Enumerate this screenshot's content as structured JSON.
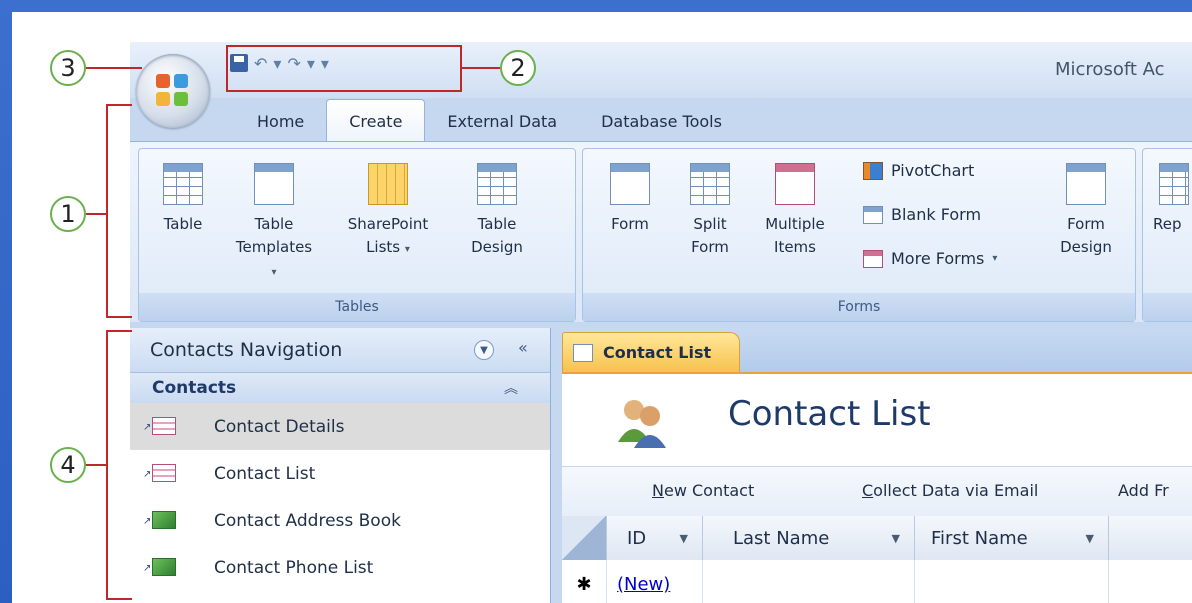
{
  "window": {
    "title": "Microsoft Ac",
    "quick_access": {
      "save": "",
      "undo": "↶",
      "redo": "↷",
      "dropdown": "▾"
    }
  },
  "tabs": [
    {
      "label": "Home",
      "active": false
    },
    {
      "label": "Create",
      "active": true
    },
    {
      "label": "External Data",
      "active": false
    },
    {
      "label": "Database Tools",
      "active": false
    }
  ],
  "ribbon": {
    "tables_group": {
      "label": "Tables",
      "table": "Table",
      "table_templates_1": "Table",
      "table_templates_2": "Templates",
      "sharepoint_1": "SharePoint",
      "sharepoint_2": "Lists",
      "table_design_1": "Table",
      "table_design_2": "Design"
    },
    "forms_group": {
      "label": "Forms",
      "form": "Form",
      "split_form_1": "Split",
      "split_form_2": "Form",
      "multiple_items_1": "Multiple",
      "multiple_items_2": "Items",
      "pivotchart": "PivotChart",
      "blank_form": "Blank Form",
      "more_forms": "More Forms",
      "form_design_1": "Form",
      "form_design_2": "Design"
    },
    "reports_partial": "Rep"
  },
  "callouts": {
    "c1": "1",
    "c2": "2",
    "c3": "3",
    "c4": "4"
  },
  "navigation": {
    "title": "Contacts Navigation",
    "collapse": "«",
    "group": "Contacts",
    "group_chevron": "≈",
    "items": [
      {
        "label": "Contact Details",
        "type": "form",
        "selected": true
      },
      {
        "label": "Contact List",
        "type": "form",
        "selected": false
      },
      {
        "label": "Contact Address Book",
        "type": "report",
        "selected": false
      },
      {
        "label": "Contact Phone List",
        "type": "report",
        "selected": false
      }
    ]
  },
  "document": {
    "tab_label": "Contact List",
    "form_title": "Contact List",
    "toolbar": {
      "new_contact_first": "N",
      "new_contact_rest": "ew Contact",
      "collect_first": "C",
      "collect_rest": "ollect Data via Email",
      "add_from": "Add Fr"
    },
    "columns": [
      "ID",
      "Last Name",
      "First Name"
    ],
    "new_row_marker": "✱",
    "new_row_id": "(New)"
  },
  "colors": {
    "accent_blue": "#2b5fc2",
    "callout_green": "#6ab04c",
    "callout_red": "#c0272d",
    "tab_orange": "#f7c24d"
  }
}
